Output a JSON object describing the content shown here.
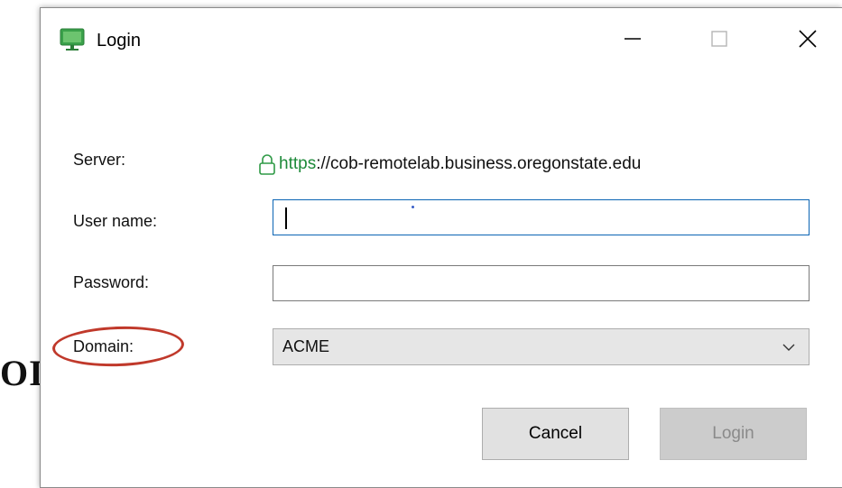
{
  "background": {
    "partial_text": "OI"
  },
  "window": {
    "title": "Login",
    "controls": {
      "minimize": "minimize-icon",
      "maximize": "maximize-icon",
      "close": "close-icon"
    }
  },
  "form": {
    "server": {
      "label": "Server:",
      "scheme": "https",
      "rest": "://cob-remotelab.business.oregonstate.edu"
    },
    "username": {
      "label": "User name:",
      "value": ""
    },
    "password": {
      "label": "Password:",
      "value": ""
    },
    "domain": {
      "label": "Domain:",
      "selected": "ACME"
    }
  },
  "buttons": {
    "cancel": "Cancel",
    "login": "Login"
  },
  "colors": {
    "accent_focus": "#0a64b4",
    "https_green": "#1e8a3a",
    "annotation_red": "#c0392b"
  }
}
